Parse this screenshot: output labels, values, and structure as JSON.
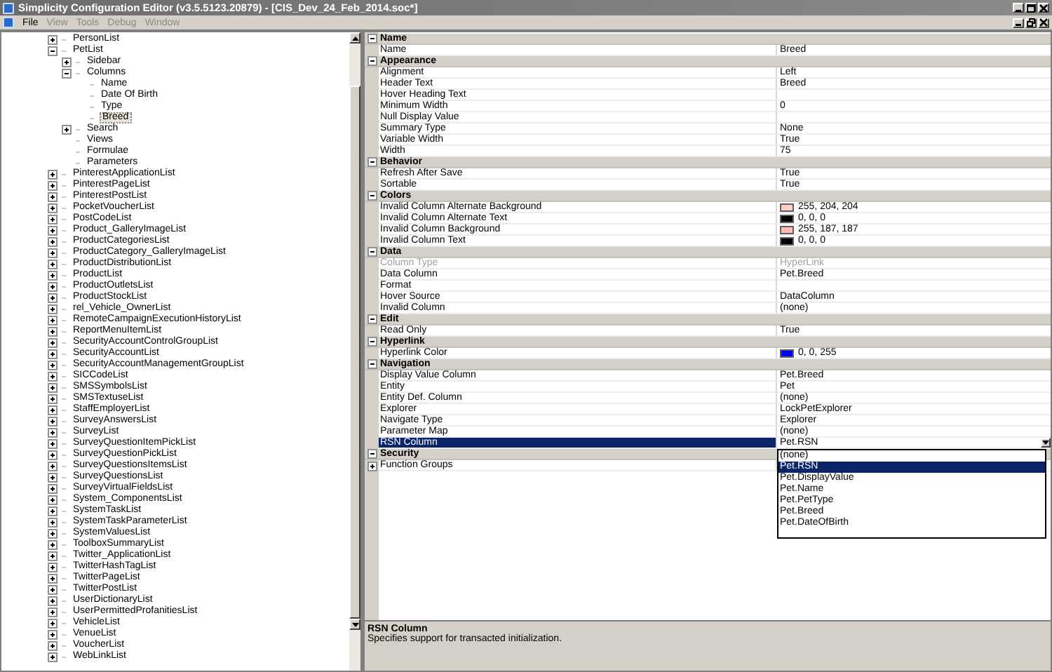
{
  "window": {
    "title": "Simplicity Configuration Editor (v3.5.5123.20879) - [CIS_Dev_24_Feb_2014.soc*]"
  },
  "menu": [
    {
      "label": "File",
      "disabled": false
    },
    {
      "label": "View",
      "disabled": true
    },
    {
      "label": "Tools",
      "disabled": true
    },
    {
      "label": "Debug",
      "disabled": true
    },
    {
      "label": "Window",
      "disabled": true
    }
  ],
  "tree": [
    {
      "label": "PersonList",
      "expanded": false,
      "selected": false
    },
    {
      "label": "PetList",
      "expanded": true,
      "selected": false,
      "children": [
        {
          "label": "Sidebar",
          "expanded": false,
          "selected": false
        },
        {
          "label": "Columns",
          "expanded": true,
          "selected": false,
          "children": [
            {
              "label": "Name",
              "selected": false
            },
            {
              "label": "Date Of Birth",
              "selected": false
            },
            {
              "label": "Type",
              "selected": false
            },
            {
              "label": "Breed",
              "selected": true
            }
          ]
        },
        {
          "label": "Search",
          "expanded": false,
          "selected": false
        },
        {
          "label": "Views",
          "selected": false
        },
        {
          "label": "Formulae",
          "selected": false
        },
        {
          "label": "Parameters",
          "selected": false
        }
      ]
    },
    {
      "label": "PinterestApplicationList",
      "expanded": false,
      "selected": false
    },
    {
      "label": "PinterestPageList",
      "expanded": false,
      "selected": false
    },
    {
      "label": "PinterestPostList",
      "expanded": false,
      "selected": false
    },
    {
      "label": "PocketVoucherList",
      "expanded": false,
      "selected": false
    },
    {
      "label": "PostCodeList",
      "expanded": false,
      "selected": false
    },
    {
      "label": "Product_GalleryImageList",
      "expanded": false,
      "selected": false
    },
    {
      "label": "ProductCategoriesList",
      "expanded": false,
      "selected": false
    },
    {
      "label": "ProductCategory_GalleryImageList",
      "expanded": false,
      "selected": false
    },
    {
      "label": "ProductDistributionList",
      "expanded": false,
      "selected": false
    },
    {
      "label": "ProductList",
      "expanded": false,
      "selected": false
    },
    {
      "label": "ProductOutletsList",
      "expanded": false,
      "selected": false
    },
    {
      "label": "ProductStockList",
      "expanded": false,
      "selected": false
    },
    {
      "label": "rel_Vehicle_OwnerList",
      "expanded": false,
      "selected": false
    },
    {
      "label": "RemoteCampaignExecutionHistoryList",
      "expanded": false,
      "selected": false
    },
    {
      "label": "ReportMenuItemList",
      "expanded": false,
      "selected": false
    },
    {
      "label": "SecurityAccountControlGroupList",
      "expanded": false,
      "selected": false
    },
    {
      "label": "SecurityAccountList",
      "expanded": false,
      "selected": false
    },
    {
      "label": "SecurityAccountManagementGroupList",
      "expanded": false,
      "selected": false
    },
    {
      "label": "SICCodeList",
      "expanded": false,
      "selected": false
    },
    {
      "label": "SMSSymbolsList",
      "expanded": false,
      "selected": false
    },
    {
      "label": "SMSTextuseList",
      "expanded": false,
      "selected": false
    },
    {
      "label": "StaffEmployerList",
      "expanded": false,
      "selected": false
    },
    {
      "label": "SurveyAnswersList",
      "expanded": false,
      "selected": false
    },
    {
      "label": "SurveyList",
      "expanded": false,
      "selected": false
    },
    {
      "label": "SurveyQuestionItemPickList",
      "expanded": false,
      "selected": false
    },
    {
      "label": "SurveyQuestionPickList",
      "expanded": false,
      "selected": false
    },
    {
      "label": "SurveyQuestionsItemsList",
      "expanded": false,
      "selected": false
    },
    {
      "label": "SurveyQuestionsList",
      "expanded": false,
      "selected": false
    },
    {
      "label": "SurveyVirtualFieldsList",
      "expanded": false,
      "selected": false
    },
    {
      "label": "System_ComponentsList",
      "expanded": false,
      "selected": false
    },
    {
      "label": "SystemTaskList",
      "expanded": false,
      "selected": false
    },
    {
      "label": "SystemTaskParameterList",
      "expanded": false,
      "selected": false
    },
    {
      "label": "SystemValuesList",
      "expanded": false,
      "selected": false
    },
    {
      "label": "ToolboxSummaryList",
      "expanded": false,
      "selected": false
    },
    {
      "label": "Twitter_ApplicationList",
      "expanded": false,
      "selected": false
    },
    {
      "label": "TwitterHashTagList",
      "expanded": false,
      "selected": false
    },
    {
      "label": "TwitterPageList",
      "expanded": false,
      "selected": false
    },
    {
      "label": "TwitterPostList",
      "expanded": false,
      "selected": false
    },
    {
      "label": "UserDictionaryList",
      "expanded": false,
      "selected": false
    },
    {
      "label": "UserPermittedProfanitiesList",
      "expanded": false,
      "selected": false
    },
    {
      "label": "VehicleList",
      "expanded": false,
      "selected": false
    },
    {
      "label": "VenueList",
      "expanded": false,
      "selected": false
    },
    {
      "label": "VoucherList",
      "expanded": false,
      "selected": false
    },
    {
      "label": "WebLinkList",
      "expanded": false,
      "selected": false
    }
  ],
  "categories": [
    {
      "label": "Name",
      "expanded": true,
      "rows": [
        {
          "kind": "text",
          "name": "Name",
          "value": "Breed",
          "selected": false,
          "disabled": false
        }
      ]
    },
    {
      "label": "Appearance",
      "expanded": true,
      "rows": [
        {
          "kind": "text",
          "name": "Alignment",
          "value": "Left",
          "selected": false,
          "disabled": false
        },
        {
          "kind": "text",
          "name": "Header Text",
          "value": "Breed",
          "selected": false,
          "disabled": false
        },
        {
          "kind": "text",
          "name": "Hover Heading Text",
          "selected": false,
          "disabled": false
        },
        {
          "kind": "text",
          "name": "Minimum Width",
          "value": "0",
          "selected": false,
          "disabled": false
        },
        {
          "kind": "text",
          "name": "Null Display Value",
          "selected": false,
          "disabled": false
        },
        {
          "kind": "text",
          "name": "Summary Type",
          "value": "None",
          "selected": false,
          "disabled": false
        },
        {
          "kind": "text",
          "name": "Variable Width",
          "value": "True",
          "selected": false,
          "disabled": false
        },
        {
          "kind": "text",
          "name": "Width",
          "value": "75",
          "selected": false,
          "disabled": false
        }
      ]
    },
    {
      "label": "Behavior",
      "expanded": true,
      "rows": [
        {
          "kind": "text",
          "name": "Refresh After Save",
          "value": "True",
          "selected": false,
          "disabled": false
        },
        {
          "kind": "text",
          "name": "Sortable",
          "value": "True",
          "selected": false,
          "disabled": false
        }
      ]
    },
    {
      "label": "Colors",
      "expanded": true,
      "rows": [
        {
          "kind": "color",
          "name": "Invalid Column Alternate Background",
          "value": "255, 204, 204",
          "color": "#ffcccc",
          "selected": false,
          "disabled": false
        },
        {
          "kind": "color",
          "name": "Invalid Column Alternate Text",
          "value": "0, 0, 0",
          "color": "#000000",
          "selected": false,
          "disabled": false
        },
        {
          "kind": "color",
          "name": "Invalid Column Background",
          "value": "255, 187, 187",
          "color": "#ffbbbb",
          "selected": false,
          "disabled": false
        },
        {
          "kind": "color",
          "name": "Invalid Column Text",
          "value": "0, 0, 0",
          "color": "#000000",
          "selected": false,
          "disabled": false
        }
      ]
    },
    {
      "label": "Data",
      "expanded": true,
      "rows": [
        {
          "kind": "text",
          "name": "Column Type",
          "value": "HyperLink",
          "selected": false,
          "disabled": true
        },
        {
          "kind": "text",
          "name": "Data Column",
          "value": "Pet.Breed",
          "selected": false,
          "disabled": false
        },
        {
          "kind": "text",
          "name": "Format",
          "selected": false,
          "disabled": false
        },
        {
          "kind": "text",
          "name": "Hover Source",
          "value": "DataColumn",
          "selected": false,
          "disabled": false
        },
        {
          "kind": "text",
          "name": "Invalid Column",
          "value": "(none)",
          "selected": false,
          "disabled": false
        }
      ]
    },
    {
      "label": "Edit",
      "expanded": true,
      "rows": [
        {
          "kind": "text",
          "name": "Read Only",
          "value": "True",
          "selected": false,
          "disabled": false
        }
      ]
    },
    {
      "label": "Hyperlink",
      "expanded": true,
      "rows": [
        {
          "kind": "color",
          "name": "Hyperlink Color",
          "value": "0, 0, 255",
          "color": "#0000ff",
          "selected": false,
          "disabled": false
        }
      ]
    },
    {
      "label": "Navigation",
      "expanded": true,
      "rows": [
        {
          "kind": "text",
          "name": "Display Value Column",
          "value": "Pet.Breed",
          "selected": false,
          "disabled": false
        },
        {
          "kind": "text",
          "name": "Entity",
          "value": "Pet",
          "selected": false,
          "disabled": false
        },
        {
          "kind": "text",
          "name": "Entity Def. Column",
          "value": "(none)",
          "selected": false,
          "disabled": false
        },
        {
          "kind": "text",
          "name": "Explorer",
          "value": "LockPetExplorer",
          "selected": false,
          "disabled": false
        },
        {
          "kind": "text",
          "name": "Navigate Type",
          "value": "Explorer",
          "selected": false,
          "disabled": false
        },
        {
          "kind": "text",
          "name": "Parameter Map",
          "value": "(none)",
          "selected": false,
          "disabled": false
        },
        {
          "kind": "dropdown",
          "name": "RSN Column",
          "value": "Pet.RSN",
          "selected": true,
          "disabled": false,
          "options": [
            {
              "label": "(none)",
              "selected": false
            },
            {
              "label": "Pet.RSN",
              "selected": true
            },
            {
              "label": "Pet.DisplayValue",
              "selected": false
            },
            {
              "label": "Pet.Name",
              "selected": false
            },
            {
              "label": "Pet.PetType",
              "selected": false
            },
            {
              "label": "Pet.Breed",
              "selected": false
            },
            {
              "label": "Pet.DateOfBirth",
              "selected": false
            }
          ]
        }
      ]
    },
    {
      "label": "Security",
      "expanded": true,
      "rows": [
        {
          "kind": "expandable",
          "name": "Function Groups",
          "selected": false,
          "disabled": false
        }
      ]
    }
  ],
  "description": {
    "title": "RSN Column",
    "text": "Specifies support for transacted initialization."
  }
}
